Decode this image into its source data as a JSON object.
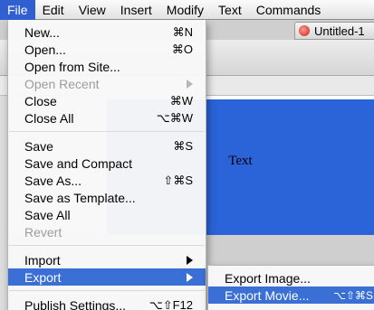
{
  "menubar": {
    "items": [
      "File",
      "Edit",
      "View",
      "Insert",
      "Modify",
      "Text",
      "Commands"
    ]
  },
  "document": {
    "tab_title": "Untitled-1",
    "stage_text": "Text"
  },
  "colors": {
    "highlight": "#3a6fd6",
    "stage_box": "#2b63d8"
  },
  "file_menu": {
    "items": [
      {
        "label": "New...",
        "shortcut": "⌘N",
        "enabled": true
      },
      {
        "label": "Open...",
        "shortcut": "⌘O",
        "enabled": true
      },
      {
        "label": "Open from Site...",
        "shortcut": "",
        "enabled": true
      },
      {
        "label": "Open Recent",
        "shortcut": "",
        "enabled": false,
        "submenu": true
      },
      {
        "label": "Close",
        "shortcut": "⌘W",
        "enabled": true
      },
      {
        "label": "Close All",
        "shortcut": "⌥⌘W",
        "enabled": true
      },
      {
        "label": "Save",
        "shortcut": "⌘S",
        "enabled": true
      },
      {
        "label": "Save and Compact",
        "shortcut": "",
        "enabled": true
      },
      {
        "label": "Save As...",
        "shortcut": "⇧⌘S",
        "enabled": true
      },
      {
        "label": "Save as Template...",
        "shortcut": "",
        "enabled": true
      },
      {
        "label": "Save All",
        "shortcut": "",
        "enabled": true
      },
      {
        "label": "Revert",
        "shortcut": "",
        "enabled": false
      },
      {
        "label": "Import",
        "shortcut": "",
        "enabled": true,
        "submenu": true
      },
      {
        "label": "Export",
        "shortcut": "",
        "enabled": true,
        "submenu": true,
        "highlighted": true
      },
      {
        "label": "Publish Settings...",
        "shortcut": "⌥⇧F12",
        "enabled": true
      }
    ]
  },
  "export_submenu": {
    "items": [
      {
        "label": "Export Image...",
        "shortcut": ""
      },
      {
        "label": "Export Movie...",
        "shortcut": "⌥⇧⌘S",
        "highlighted": true
      }
    ]
  }
}
